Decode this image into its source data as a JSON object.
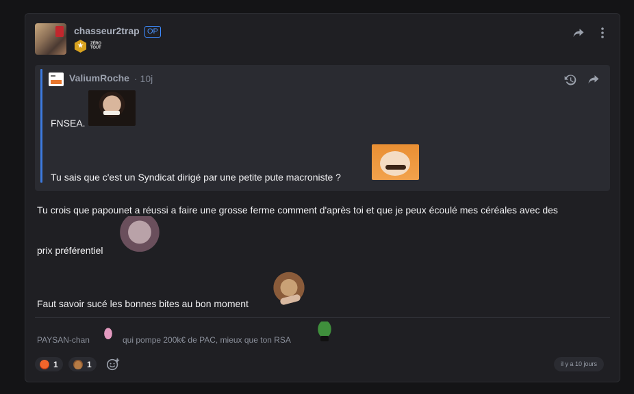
{
  "post": {
    "author": "chasseur2trap",
    "op_label": "OP",
    "badge_text": "ZÉRO TOUT",
    "share_icon": "share-icon",
    "more_icon": "more-vertical-icon"
  },
  "quote": {
    "author": "ValiumRoche",
    "meta": "· 10j",
    "lines": [
      "FNSEA.",
      "Tu sais que c'est un Syndicat dirigé par une petite pute macroniste ?"
    ],
    "history_icon": "history-icon",
    "share_icon": "share-icon"
  },
  "body": {
    "lines": [
      "Tu crois que papounet a réussi a faire une grosse ferme comment d'après toi et que je peux écoulé mes céréales avec des",
      "prix préférentiel",
      "Faut savoir sucé les bonnes bites au bon moment"
    ]
  },
  "signature": {
    "name": "PAYSAN-chan",
    "text": "qui pompe 200k€ de PAC, mieux que ton RSA"
  },
  "reactions": [
    {
      "emoji": "angry-face",
      "count": "1",
      "color": "#f2652b"
    },
    {
      "emoji": "poop",
      "count": "1",
      "color": "#b57b45"
    }
  ],
  "timestamp": "il y a 10 jours",
  "colors": {
    "background": "#141416",
    "card": "#1f1f23",
    "quote_bg": "#2a2b31",
    "accent": "#3d7be0"
  }
}
